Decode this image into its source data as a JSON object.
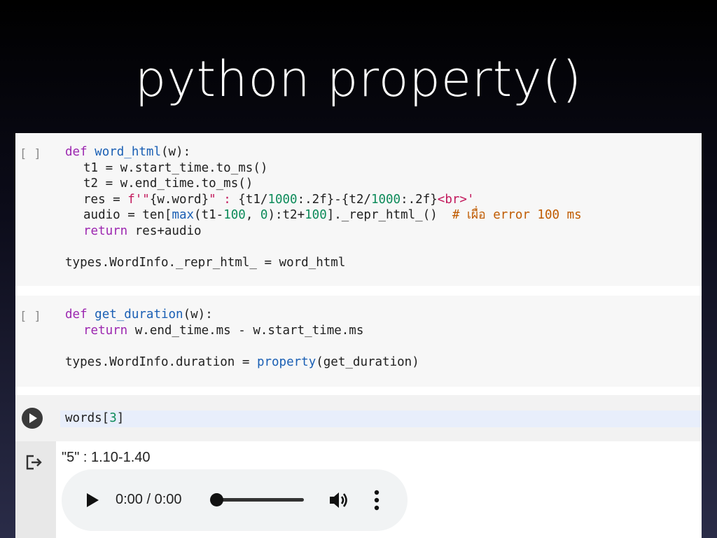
{
  "slide": {
    "title": "python property()"
  },
  "cells": [
    {
      "bracket": "[ ]",
      "lines": {
        "l1_kw": "def",
        "l1_fn": "word_html",
        "l1_rest": "(w):",
        "l2": "t1 = w.start_time.to_ms()",
        "l3": "t2 = w.end_time.to_ms()",
        "l4_a": "res = ",
        "l4_str1": "f'\"",
        "l4_b": "{w.word}",
        "l4_str2": "\" : ",
        "l4_c": "{t1/",
        "l4_n1": "1000",
        "l4_d": ":.2f}-{t2/",
        "l4_n2": "1000",
        "l4_e": ":.2f}",
        "l4_str3": "<br>'",
        "l5_a": "audio = ten[",
        "l5_max": "max",
        "l5_b": "(t1-",
        "l5_n1": "100",
        "l5_c": ", ",
        "l5_n2": "0",
        "l5_d": "):t2+",
        "l5_n3": "100",
        "l5_e": "]._repr_html_()  ",
        "l5_cm": "# เผื่อ error 100 ms",
        "l6_kw": "return",
        "l6_rest": " res+audio",
        "l8": "types.WordInfo._repr_html_ = word_html"
      }
    },
    {
      "bracket": "[ ]",
      "lines": {
        "l1_kw": "def",
        "l1_fn": "get_duration",
        "l1_rest": "(w):",
        "l2_kw": "return",
        "l2_rest": " w.end_time.ms - w.start_time.ms",
        "l4_a": "types.WordInfo.duration = ",
        "l4_bi": "property",
        "l4_b": "(get_duration)"
      }
    }
  ],
  "run_cell": {
    "code_a": "words[",
    "code_num": "3",
    "code_b": "]"
  },
  "output": {
    "text": "\"5\" : 1.10-1.40",
    "audio": {
      "time": "0:00 / 0:00",
      "progress": 0
    },
    "icons": {
      "output": "output-redirect-icon",
      "play": "play-icon",
      "volume": "volume-icon",
      "more": "more-vert-icon"
    }
  }
}
